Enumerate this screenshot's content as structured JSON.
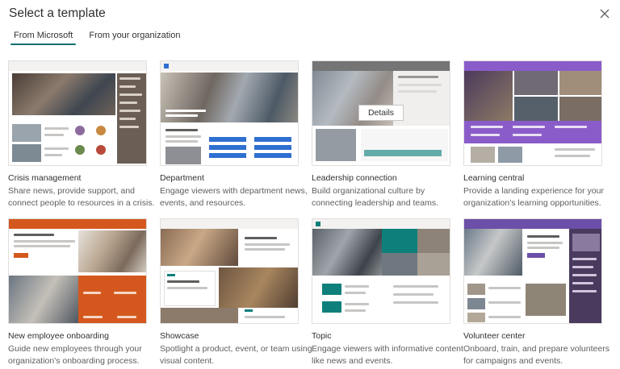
{
  "dialog": {
    "title": "Select a template",
    "close_icon": "close-icon"
  },
  "tabs": [
    {
      "label": "From Microsoft",
      "active": true
    },
    {
      "label": "From your organization",
      "active": false
    }
  ],
  "hover_button": "Details",
  "templates": [
    {
      "title": "Crisis management",
      "description": "Share news, provide support, and connect people to resources in a crisis."
    },
    {
      "title": "Department",
      "description": "Engage viewers with department news, events, and resources."
    },
    {
      "title": "Leadership connection",
      "description": "Build organizational culture by connecting leadership and teams."
    },
    {
      "title": "Learning central",
      "description": "Provide a landing experience for your organization's learning opportunities."
    },
    {
      "title": "New employee onboarding",
      "description": "Guide new employees through your organization's onboarding process."
    },
    {
      "title": "Showcase",
      "description": "Spotlight a product, event, or team using visual content."
    },
    {
      "title": "Topic",
      "description": "Engage viewers with informative content like news and events."
    },
    {
      "title": "Volunteer center",
      "description": "Onboard, train, and prepare volunteers for campaigns and events."
    }
  ],
  "colors": {
    "tab_underline": "#0f6e6e",
    "crisis_accent": "#6b5e55",
    "department_accent": "#2f6fd1",
    "leadership_accent": "#2b2b2b",
    "learning_accent": "#8a5cc9",
    "onboarding_accent": "#d4581d",
    "showcase_accent": "#0e7f7a",
    "topic_accent": "#0e7f7a",
    "volunteer_accent": "#6c4fa8"
  }
}
